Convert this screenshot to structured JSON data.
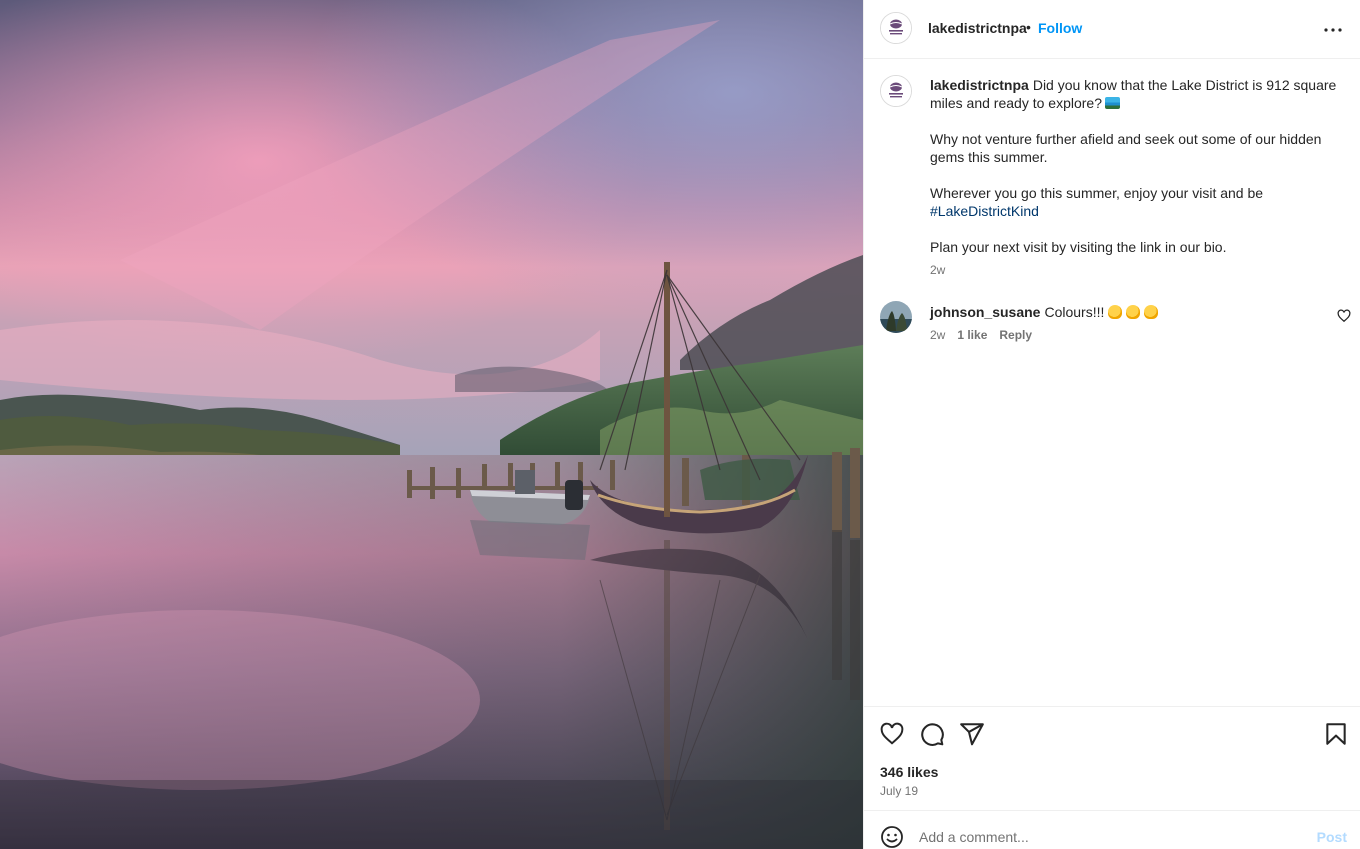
{
  "post": {
    "username": "lakedistrictnpa",
    "follow_label": "Follow",
    "separator": "•",
    "image_alt": "Lake Derwentwater at dusk with a moored wooden sailing boat and a motor boat beside a jetty under a pink sky"
  },
  "caption": {
    "username": "lakedistrictnpa",
    "paragraph1": "Did you know that the Lake District is 912 square miles and ready to explore?",
    "paragraph2": "Why not venture further afield and seek out some of our hidden gems this summer.",
    "paragraph3": "Wherever you go this summer, enjoy your visit and be",
    "hashtag": "#LakeDistrictKind",
    "paragraph4": "Plan your next visit by visiting the link in our bio.",
    "time": "2w",
    "emoji_icon": "lake-scene-emoji-icon"
  },
  "comments": [
    {
      "username": "johnson_susane",
      "text": "Colours!!!",
      "time": "2w",
      "likes": "1 like",
      "reply_label": "Reply",
      "emoji_icon": "clapping-hands-emoji-icon"
    }
  ],
  "actions": {
    "likes": "346 likes",
    "date": "July 19",
    "icons": [
      "heart-icon",
      "comment-icon",
      "share-icon",
      "bookmark-icon"
    ]
  },
  "comment_box": {
    "placeholder": "Add a comment...",
    "post_label": "Post"
  },
  "colors": {
    "link_blue": "#0095f6",
    "hashtag_blue": "#00376b",
    "muted_text": "#737373",
    "post_disabled": "#b3dbff"
  }
}
